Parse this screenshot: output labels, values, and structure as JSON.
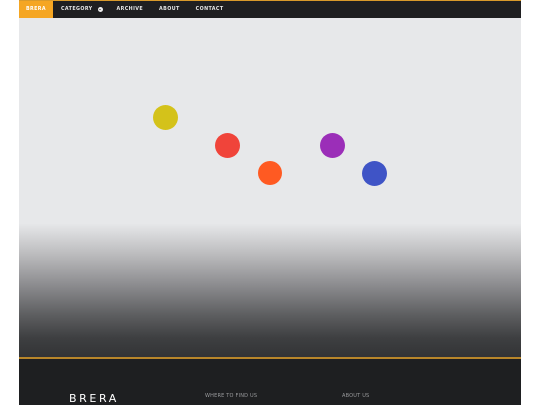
{
  "nav": {
    "items": [
      {
        "label": "BRERA",
        "active": true
      },
      {
        "label": "CATEGORY",
        "has_dropdown": true
      },
      {
        "label": "ARCHIVE"
      },
      {
        "label": "ABOUT"
      },
      {
        "label": "CONTACT"
      }
    ],
    "accent_color": "#f5a623"
  },
  "hero": {
    "dots": [
      {
        "name": "yellow",
        "color": "#d4c21a"
      },
      {
        "name": "red",
        "color": "#f0443a"
      },
      {
        "name": "orange",
        "color": "#ff5a22"
      },
      {
        "name": "purple",
        "color": "#9b2eb8"
      },
      {
        "name": "blue",
        "color": "#3f54c6"
      }
    ]
  },
  "footer": {
    "logo": "BRERA",
    "where_heading": "WHERE TO FIND US",
    "about_heading": "ABOUT US",
    "divider_color": "#b8862a"
  }
}
